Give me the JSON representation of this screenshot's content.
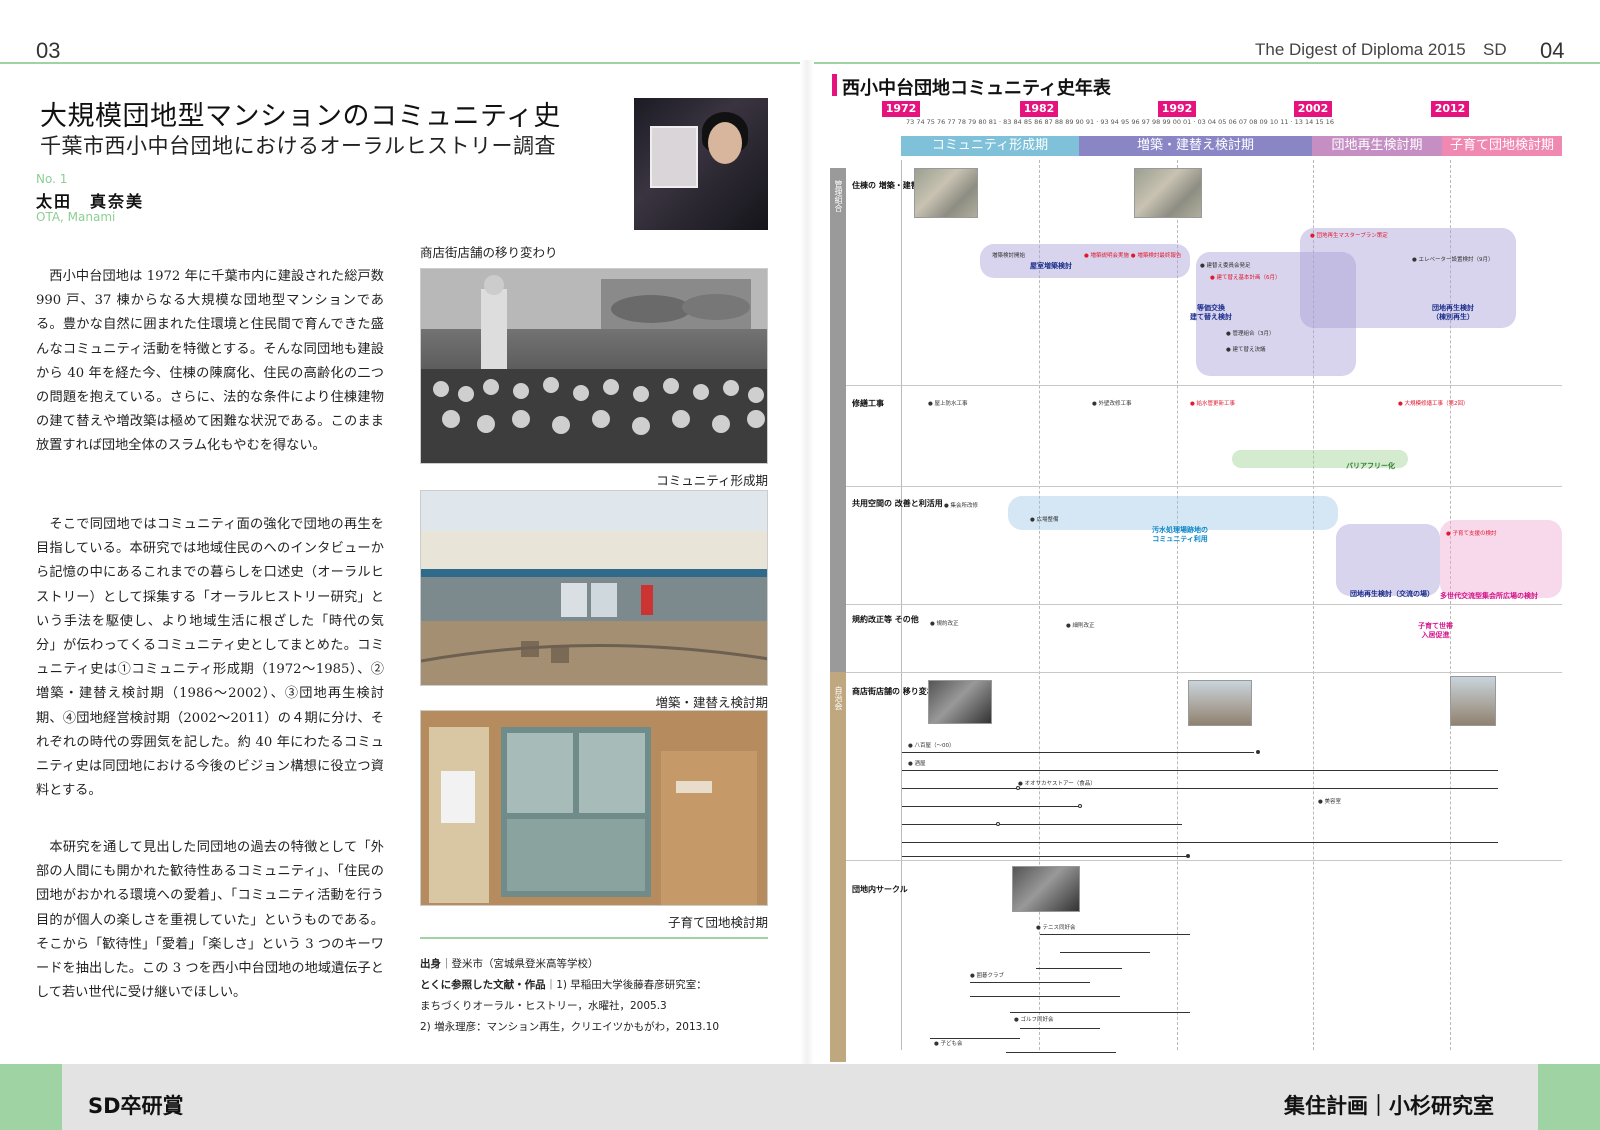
{
  "header": {
    "page_left": "03",
    "page_right": "04",
    "magazine_title": "The Digest of Diploma 2015",
    "section_abbr": "SD"
  },
  "article": {
    "title": "大規模団地型マンションのコミュニティ史",
    "subtitle": "千葉市西小中台団地におけるオーラルヒストリー調査",
    "number": "No. 1",
    "author": "太田　真奈美",
    "author_romaji": "OTA, Manami",
    "paragraphs": [
      "西小中台団地は 1972 年に千葉市内に建設された総戸数 990 戸、37 棟からなる大規模な団地型マンションである。豊かな自然に囲まれた住環境と住民間で育んできた盛んなコミュニティ活動を特徴とする。そんな同団地も建設から 40 年を経た今、住棟の陳腐化、住民の高齢化の二つの問題を抱えている。さらに、法的な条件により住棟建物の建て替えや増改築は極めて困難な状況である。このまま放置すれば団地全体のスラム化もやむを得ない。",
      "そこで同団地ではコミュニティ面の強化で団地の再生を目指している。本研究では地域住民のへのインタビューから記憶の中にあるこれまでの暮らしを口述史（オーラルヒストリー）として採集する「オーラルヒストリー研究」という手法を駆使し、より地域生活に根ざした「時代の気分」が伝わってくるコミュニティ史としてまとめた。コミュニティ史は①コミュニティ形成期（1972～1985）、②増築・建替え検討期（1986～2002）、③団地再生検討期、④団地経営検討期（2002～2011）の４期に分け、それぞれの時代の雰囲気を記した。約 40 年にわたるコミュニティ史は同団地における今後のビジョン構想に役立つ資料とする。",
      "本研究を通して見出した同団地の過去の特徴として「外部の人間にも開かれた歓待性あるコミュニティ」、「住民の団地がおかれる環境への愛着」、「コミュニティ活動を行う目的が個人の楽しさを重視していた」というものである。そこから「歓待性」「愛着」「楽しさ」という 3 つのキーワードを抽出した。この 3 つを西小中台団地の地域遺伝子として若い世代に受け継いでほしい。"
    ],
    "photo_section_caption": "商店街店舗の移り変わり",
    "photo_captions": [
      "コミュニティ形成期",
      "増築・建替え検討期",
      "子育て団地検討期"
    ],
    "refs": {
      "origin_label": "出身",
      "origin_value": "登米市（宮城県登米高等学校）",
      "ref_label": "とくに参照した文献・作品",
      "ref1_line1": "1) 早稲田大学後藤春彦研究室：",
      "ref1_line2": "まちづくりオーラル・ヒストリー，水曜社，2005.3",
      "ref2": "2) 増永理彦：マンション再生，クリエイツかもがわ，2013.10"
    }
  },
  "timeline": {
    "title": "西小中台団地コミュニティ史年表",
    "year_badges": [
      "1972",
      "1982",
      "1992",
      "2002",
      "2012"
    ],
    "ticks": "73 74 75 76 77 78 79 80 81 · 83 84 85 86 87 88 89 90 91 · 93 94 95 96 97 98 99 00 01 · 03 04 05 06 07 08 09 10 11 · 13 14 15 16",
    "periods": [
      "コミュニティ形成期",
      "増築・建替え検討期",
      "団地再生検討期",
      "子育て団地検討期"
    ],
    "sidebar_labels": [
      "管理組合",
      "自治会"
    ],
    "sections": [
      "住棟の\n増築・建替え",
      "修繕工事",
      "共用空間の\n改善と利活用",
      "規約改正等\nその他",
      "商店街店舗の\n移り変わり",
      "団地内サークル"
    ],
    "notes": {
      "rooftop": "屋室増築検討",
      "equiv_exchange": "等価交換\n建て替え検討",
      "regeneration": "団地再生検討\n（棟別再生）",
      "barrier_free": "バリアフリー化",
      "sewage": "汚水処理場跡地の\nコミュニティ利用",
      "regen_exchange": "団地再生検討（交流の場）",
      "child_moving": "子育て世帯\n入居促進",
      "multi_gen": "多世代交流型集会所広場の検討"
    },
    "minor_text": {
      "r1a": "増築検討開始",
      "r1b": "● 増築説明会実施 ● 増築検討最終報告",
      "r1c": "● 建替え委員会発足",
      "r1d": "● 建て替え基本計画（6月）",
      "r1e": "● 管理組合（3月）",
      "r1f": "● 団地再生マスタープラン策定",
      "r1g": "● エレベーター設置検討（9月）",
      "r1h": "● 建て替え決議",
      "r2a": "● 屋上防水工事",
      "r2b": "● 外壁改修工事",
      "r2c": "● 給水管更新工事",
      "r2d": "● 大規模修繕工事（第2回）",
      "r3a": "● 集会所改修",
      "r3b": "● 広場整備",
      "r3c": "● 子育て支援の検討",
      "r4a": "● 規約改正",
      "r4b": "● 細則改正",
      "shop1": "● 八百屋（〜00）",
      "shop2": "● 酒屋",
      "shop3": "● オオサカヤストアー（食品）",
      "shop4": "● 美容室",
      "circle1": "● テニス同好会",
      "circle2": "● ゴルフ同好会",
      "circle3": "● 囲碁クラブ",
      "circle4": "● 子ども会"
    }
  }
}
